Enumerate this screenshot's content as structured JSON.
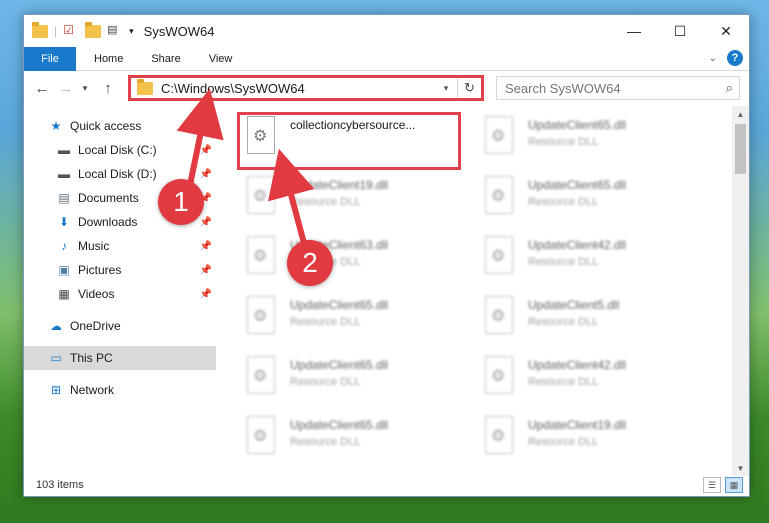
{
  "window": {
    "title": "SysWOW64",
    "controls": {
      "minimize": "—",
      "maximize": "☐",
      "close": "✕"
    }
  },
  "ribbon": {
    "tabs": [
      "File",
      "Home",
      "Share",
      "View"
    ],
    "help": "?"
  },
  "address": {
    "path": "C:\\Windows\\SysWOW64",
    "search_placeholder": "Search SysWOW64"
  },
  "sidebar": {
    "items": [
      {
        "label": "Quick access",
        "icon": "star-icon"
      },
      {
        "label": "Local Disk (C:)",
        "icon": "drive-icon",
        "pinned": true
      },
      {
        "label": "Local Disk (D:)",
        "icon": "drive-icon",
        "pinned": true
      },
      {
        "label": "Documents",
        "icon": "documents-icon",
        "pinned": true
      },
      {
        "label": "Downloads",
        "icon": "downloads-icon",
        "pinned": true
      },
      {
        "label": "Music",
        "icon": "music-icon",
        "pinned": true
      },
      {
        "label": "Pictures",
        "icon": "pictures-icon",
        "pinned": true
      },
      {
        "label": "Videos",
        "icon": "videos-icon",
        "pinned": true
      },
      {
        "label": "OneDrive",
        "icon": "cloud-icon"
      },
      {
        "label": "This PC",
        "icon": "computer-icon",
        "selected": true
      },
      {
        "label": "Network",
        "icon": "network-icon"
      }
    ]
  },
  "files": [
    {
      "name": "collectioncybersource...",
      "type": ""
    },
    {
      "name": "UpdateClient65.dll",
      "type": "Resource DLL"
    },
    {
      "name": "UpdateClient19.dll",
      "type": "Resource DLL"
    },
    {
      "name": "UpdateClient65.dll",
      "type": "Resource DLL"
    },
    {
      "name": "UpdateClient63.dll",
      "type": "Resource DLL"
    },
    {
      "name": "UpdateClient42.dll",
      "type": "Resource DLL"
    },
    {
      "name": "UpdateClient65.dll",
      "type": "Resource DLL"
    },
    {
      "name": "UpdateClient5.dll",
      "type": "Resource DLL"
    },
    {
      "name": "UpdateClient65.dll",
      "type": "Resource DLL"
    },
    {
      "name": "UpdateClient42.dll",
      "type": "Resource DLL"
    },
    {
      "name": "UpdateClient65.dll",
      "type": "Resource DLL"
    },
    {
      "name": "UpdateClient19.dll",
      "type": "Resource DLL"
    }
  ],
  "status": {
    "item_count": "103 items"
  },
  "annotations": {
    "badge1": "1",
    "badge2": "2",
    "color": "#e23a41"
  }
}
